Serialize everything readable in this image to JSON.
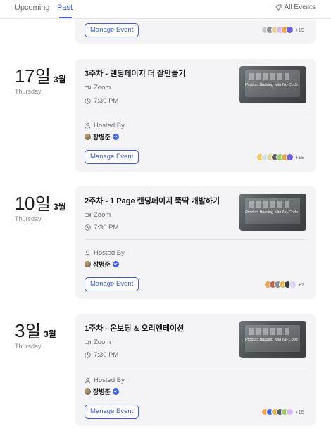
{
  "tabs": {
    "upcoming": "Upcoming",
    "past": "Past",
    "active": "Past"
  },
  "all_events": "All Events",
  "previous_card": {
    "manage_label": "Manage Event",
    "extra_count": "+19"
  },
  "events": [
    {
      "day": "17",
      "day_suffix": "일",
      "month": "3월",
      "weekday": "Thursday",
      "title": "3주차 - 랜딩페이지 더 잘만들기",
      "platform": "Zoom",
      "time": "7:30 PM",
      "hosted_by_label": "Hosted By",
      "host_name": "장병준",
      "thumbnail_caption": "Product Building with No-Code",
      "manage_label": "Manage Event",
      "extra_count": "+18"
    },
    {
      "day": "10",
      "day_suffix": "일",
      "month": "3월",
      "weekday": "Thursday",
      "title": "2주차 - 1 Page 랜딩페이지 뚝딱 개발하기",
      "platform": "Zoom",
      "time": "7:30 PM",
      "hosted_by_label": "Hosted By",
      "host_name": "장병준",
      "thumbnail_caption": "Product Building with No-Code",
      "manage_label": "Manage Event",
      "extra_count": "+7"
    },
    {
      "day": "3",
      "day_suffix": "일",
      "month": "3월",
      "weekday": "Thursday",
      "title": "1주차 - 온보딩 & 오리엔테이션",
      "platform": "Zoom",
      "time": "7:30 PM",
      "hosted_by_label": "Hosted By",
      "host_name": "장병준",
      "thumbnail_caption": "Product Building with No-Code",
      "manage_label": "Manage Event",
      "extra_count": "+15"
    }
  ],
  "colors": {
    "accent": "#3b5bdb",
    "card_bg": "#f4f4f6",
    "muted_text": "#6b6b73"
  }
}
